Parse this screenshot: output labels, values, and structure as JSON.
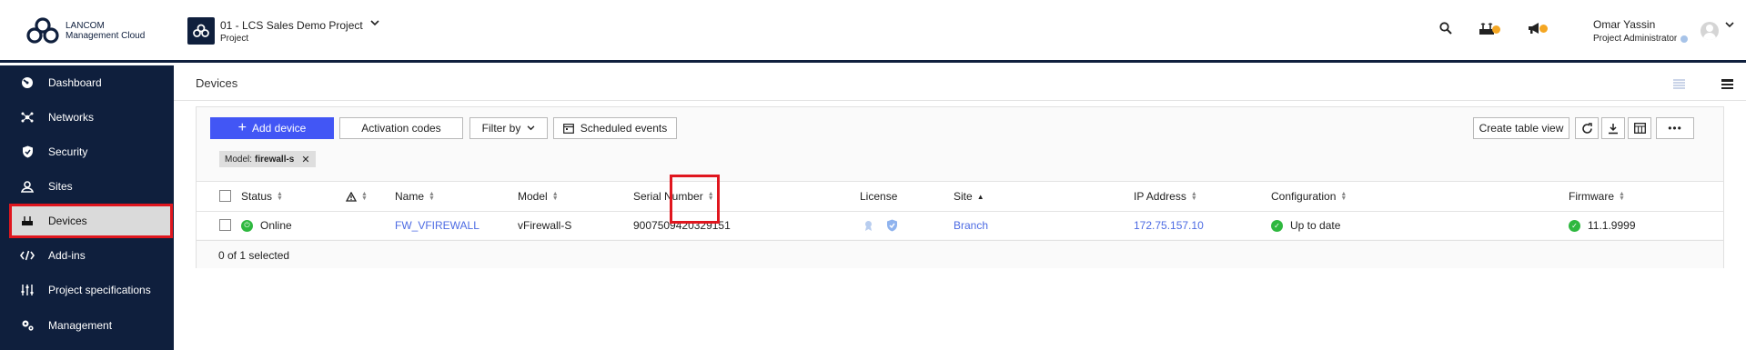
{
  "brand": {
    "line1": "LANCOM",
    "line2": "Management Cloud"
  },
  "project": {
    "title": "01 - LCS Sales Demo Project",
    "subtitle": "Project"
  },
  "user": {
    "name": "Omar Yassin",
    "role": "Project Administrator"
  },
  "sidebar": {
    "items": [
      {
        "label": "Dashboard",
        "icon": "dashboard-icon"
      },
      {
        "label": "Networks",
        "icon": "networks-icon"
      },
      {
        "label": "Security",
        "icon": "shield-icon"
      },
      {
        "label": "Sites",
        "icon": "sites-icon"
      },
      {
        "label": "Devices",
        "icon": "router-icon",
        "active": true
      },
      {
        "label": "Add-ins",
        "icon": "code-icon"
      },
      {
        "label": "Project specifications",
        "icon": "sliders-icon"
      },
      {
        "label": "Management",
        "icon": "gears-icon"
      }
    ]
  },
  "page": {
    "title": "Devices"
  },
  "toolbar": {
    "add_device": "Add device",
    "activation_codes": "Activation codes",
    "filter_by": "Filter by",
    "scheduled_events": "Scheduled events",
    "create_table_view": "Create table view"
  },
  "filter_chip": {
    "key": "Model:",
    "value": "firewall-s"
  },
  "table": {
    "headers": {
      "status": "Status",
      "name": "Name",
      "model": "Model",
      "serial": "Serial Number",
      "license": "License",
      "site": "Site",
      "ip": "IP Address",
      "configuration": "Configuration",
      "firmware": "Firmware"
    },
    "rows": [
      {
        "status": "Online",
        "name": "FW_VFIREWALL",
        "model": "vFirewall-S",
        "serial": "9007509420329151",
        "site": "Branch",
        "ip": "172.75.157.10",
        "configuration": "Up to date",
        "firmware": "11.1.9999"
      }
    ],
    "selection": "0 of 1 selected"
  },
  "colors": {
    "navy": "#0f1f3d",
    "accent": "#4256f5",
    "highlight": "#e0161e",
    "online": "#2eb83f",
    "notification": "#f4a622"
  }
}
